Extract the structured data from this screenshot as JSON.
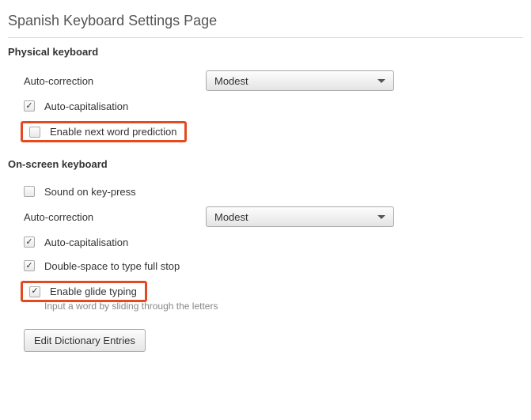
{
  "page_title": "Spanish Keyboard Settings Page",
  "physical": {
    "title": "Physical keyboard",
    "auto_correction_label": "Auto-correction",
    "auto_correction_value": "Modest",
    "auto_capitalisation_label": "Auto-capitalisation",
    "auto_capitalisation_checked": true,
    "next_word_prediction_label": "Enable next word prediction",
    "next_word_prediction_checked": false
  },
  "onscreen": {
    "title": "On-screen keyboard",
    "sound_label": "Sound on key-press",
    "sound_checked": false,
    "auto_correction_label": "Auto-correction",
    "auto_correction_value": "Modest",
    "auto_capitalisation_label": "Auto-capitalisation",
    "auto_capitalisation_checked": true,
    "double_space_label": "Double-space to type full stop",
    "double_space_checked": true,
    "glide_label": "Enable glide typing",
    "glide_checked": true,
    "glide_hint": "Input a word by sliding through the letters",
    "edit_dict_label": "Edit Dictionary Entries"
  }
}
